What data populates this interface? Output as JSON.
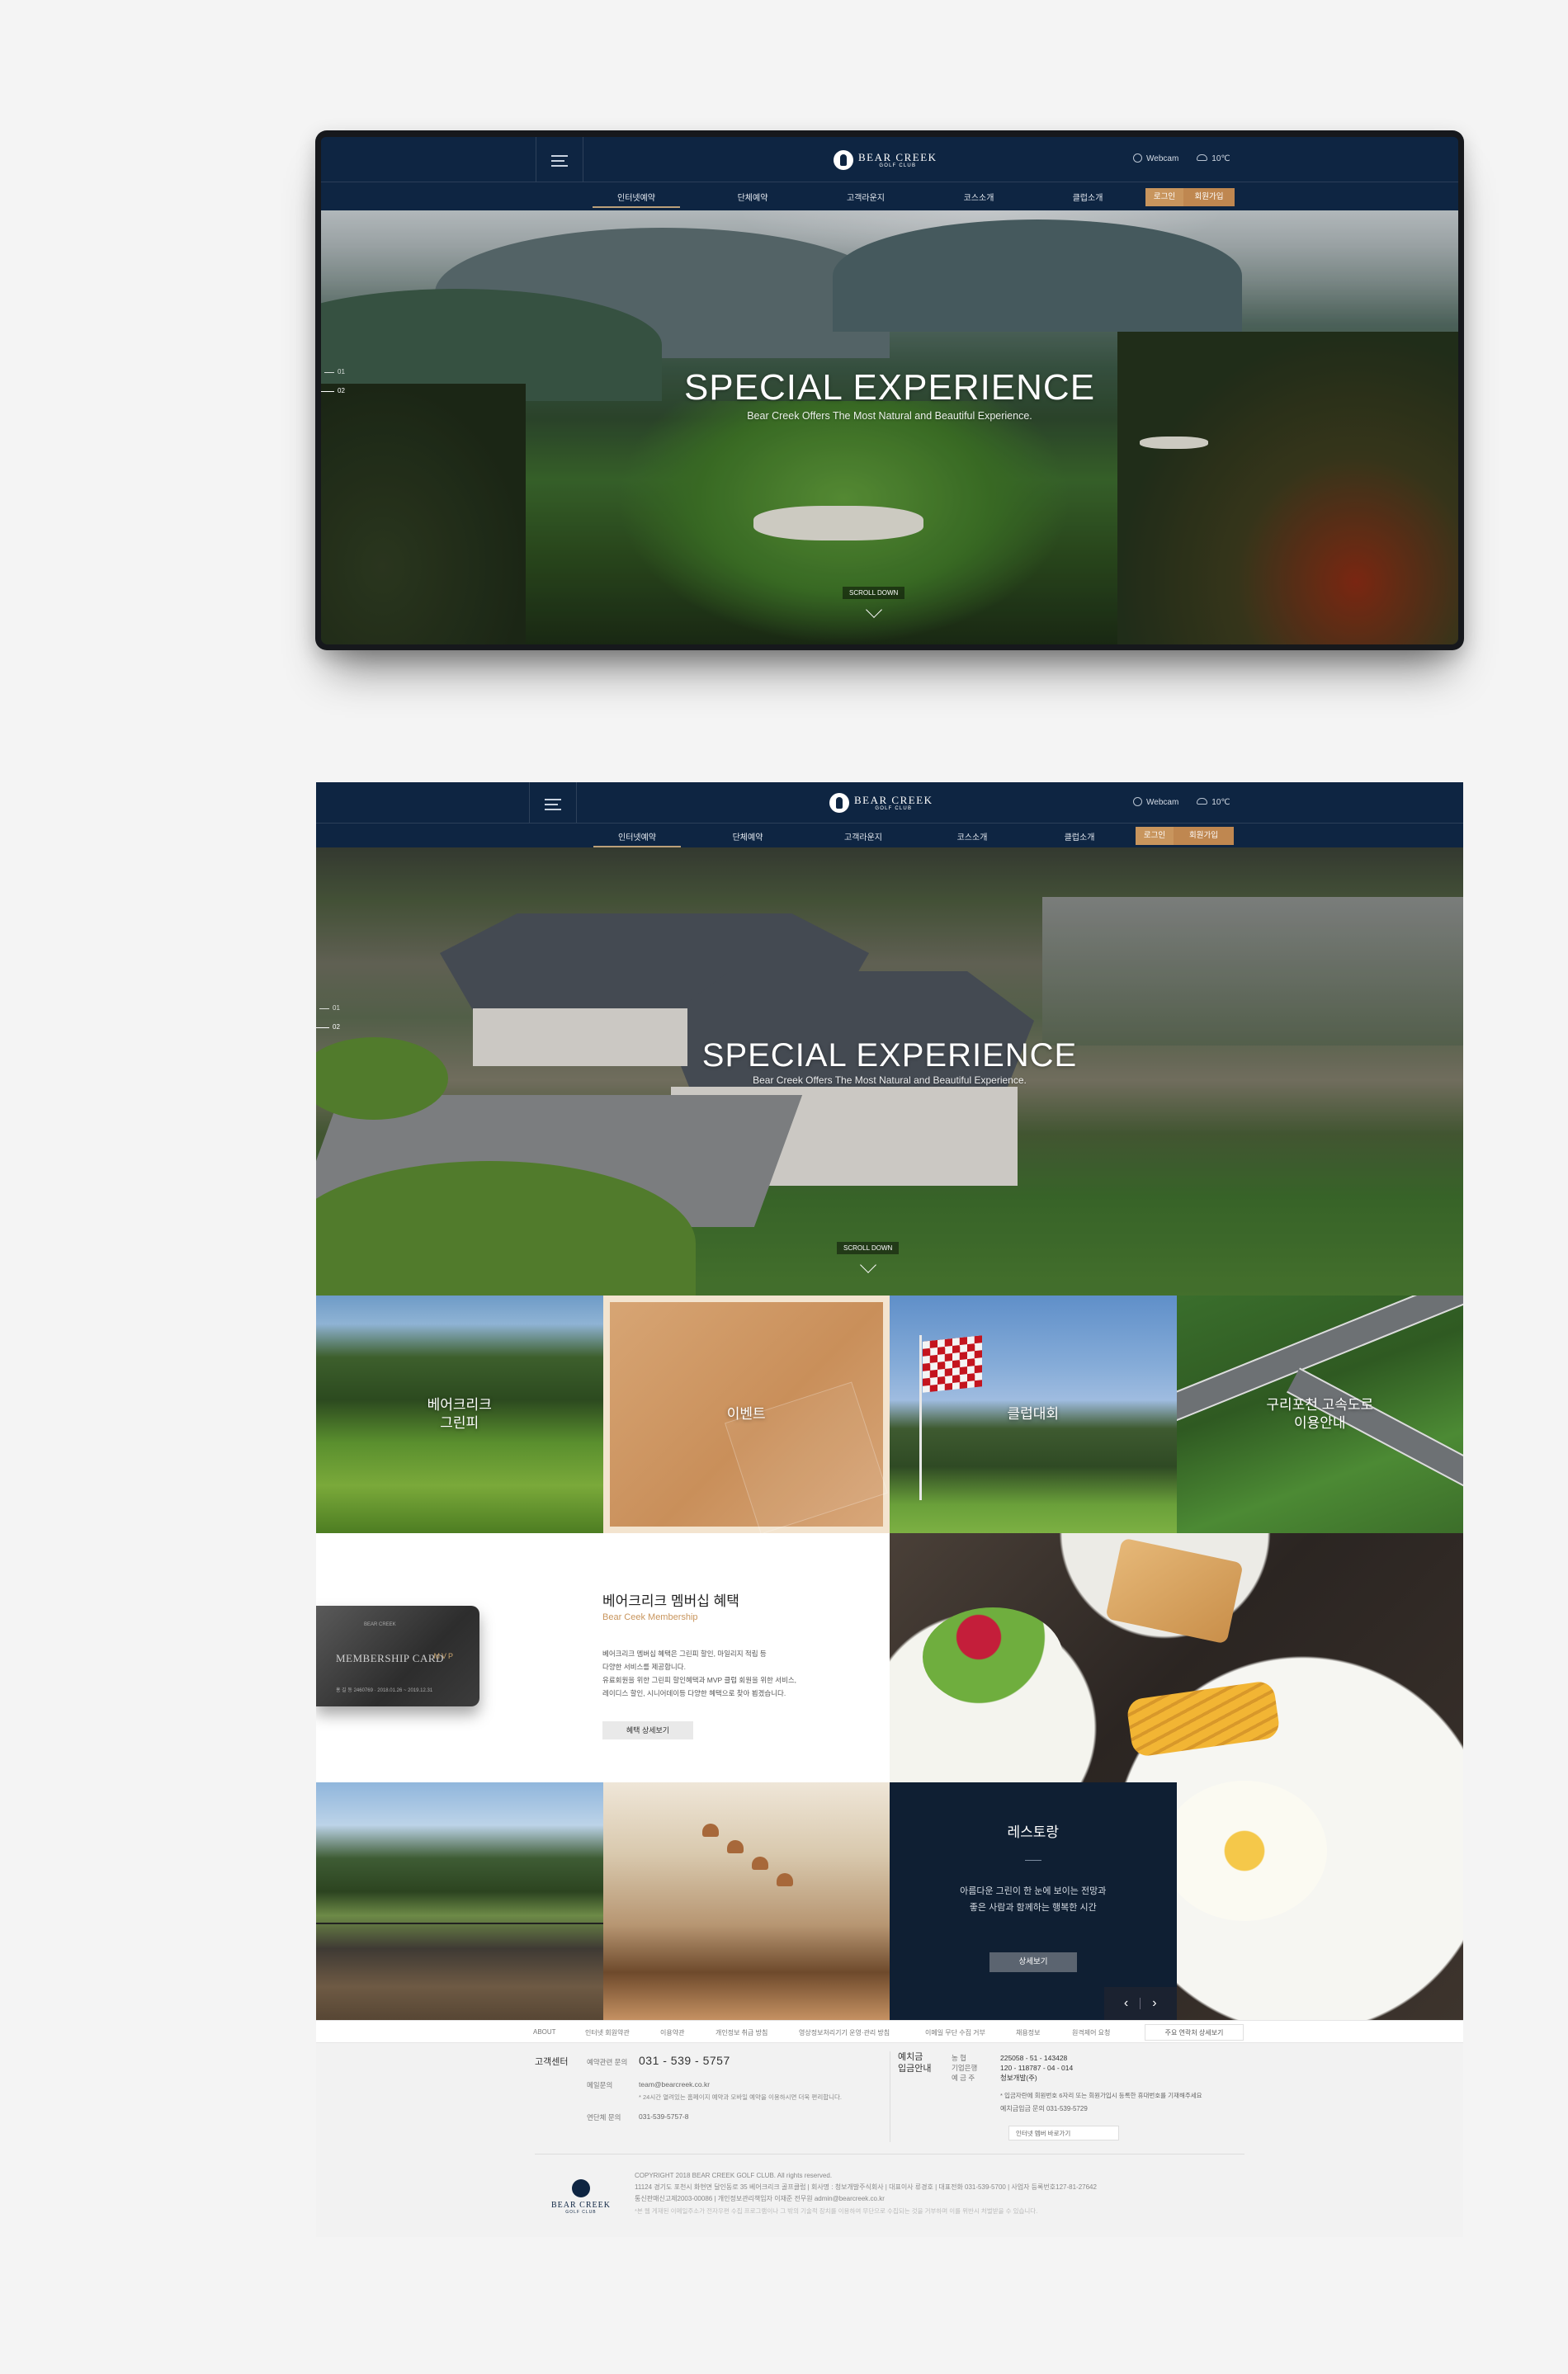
{
  "brand": {
    "name": "BEAR CREEK",
    "sub": "GOLF CLUB"
  },
  "header": {
    "webcam": "Webcam",
    "temperature": "10℃",
    "nav": [
      "인터넷예약",
      "단체예약",
      "고객라운지",
      "코스소개",
      "클럽소개"
    ],
    "login": "로그인",
    "join": "회원가입"
  },
  "hero": {
    "title": "SPECIAL EXPERIENCE",
    "subtitle": "Bear Creek Offers The Most Natural and Beautiful Experience.",
    "pager": [
      "01",
      "02"
    ],
    "scroll": "SCROLL DOWN"
  },
  "hero_top_pager": [
    "01",
    "02"
  ],
  "tiles": [
    {
      "label": "베어크리크\n그린피"
    },
    {
      "label": "이벤트"
    },
    {
      "label": "클럽대회"
    },
    {
      "label": "구리포천 고속도로\n이용안내"
    }
  ],
  "membership": {
    "title": "베어크리크 멤버십 혜택",
    "subtitle": "Bear Ceek Membership",
    "desc": [
      "베어크리크 멤버십 혜택은 그린피 할인, 마일리지 적립 등",
      "다양한 서비스를 제공합니다.",
      "유료회원을 위한 그린피 할인혜택과 MVP 클럽 회원을 위한 서비스,",
      "레이디스 할인, 시니어데이등 다양한 혜택으로 찾아 뵙겠습니다."
    ],
    "more": "혜택 상세보기",
    "card": {
      "name": "MEMBERSHIP CARD",
      "grade": "MVP",
      "brand": "BEAR CREEK",
      "holder": "홍 길 동",
      "number": "2460769 · 2018.01.26 ~ 2019.12.31"
    }
  },
  "restaurant": {
    "title": "레스토랑",
    "lines": [
      "아름다운 그린이 한 눈에 보이는 전망과",
      "좋은 사람과 함께하는 행복한 시간"
    ],
    "more": "상세보기"
  },
  "footer_nav": {
    "items": [
      "ABOUT",
      "인터넷 회원약관",
      "이용약관",
      "개인정보 취급 방침",
      "영상정보처리기기 운영·관리 방침",
      "이메일 무단 수집 거부",
      "채용정보",
      "원격제어 요청"
    ],
    "related": "주요 연락처 상세보기"
  },
  "footer": {
    "cs_title": "고객센터",
    "reserve_label": "예약관련 문의",
    "reserve_tel": "031 - 539 - 5757",
    "email_label": "메일문의",
    "email": "team@bearcreek.co.kr",
    "email_note": "* 24시간 열려있는 홈페이지 예약과 모바일 예약을 이용하시면 더욱 편리합니다.",
    "group_label": "연단체 문의",
    "group_tel": "031-539-5757-8",
    "deposit_title": [
      "예치금",
      "입금안내"
    ],
    "deposit_labels": [
      "농 협",
      "기업은행",
      "예 금 주"
    ],
    "deposit_vals": [
      "225058 - 51 - 143428",
      "120 - 118787 - 04 - 014",
      "청보개발(주)"
    ],
    "deposit_note": "* 입금자란에 회원번호 6자리 또는 회원가입시 등록한 휴대번호를 기재해주세요",
    "deposit_tel": "예치금입금 문의 031-539-5729",
    "apply": "인터넷 멤버 바로가기",
    "copyright": "COPYRIGHT 2018  BEAR CREEK GOLF CLUB. All rights reserved.",
    "addr1": "11124 경기도 포천시 화현면 달인동로 35 베어크리크 골프클럽  |  회사명 : 청보개발주식회사  |  대표이사 류경호  |  대표전화 031-539-5700  |  사업자 등록번호127-81-27642",
    "addr2": "통신판매신고제2003-00086  |  개인정보관리책임자 이재준 전무원 admin@bearcreek.co.kr",
    "notice": "*본 웹 게재된 이메일주소가 전자우편 수집 프로그램이나 그 밖의 기술적 장치를 이용하여 무단으로 수집되는 것을 거부하며 이를 위반시 처벌받을 수 있습니다."
  },
  "colors": {
    "navy": "#0e2542",
    "gold": "#c8955d",
    "restaurant_bg": "#0f1f33"
  }
}
